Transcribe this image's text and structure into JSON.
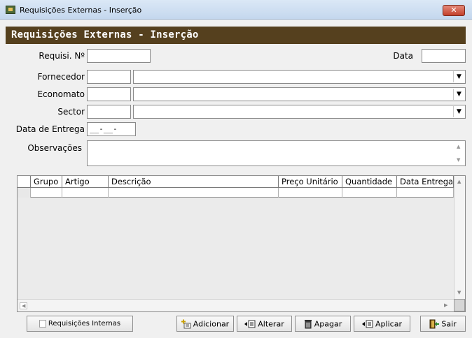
{
  "window": {
    "title": "Requisições Externas - Inserção",
    "close_label": "✕"
  },
  "header": {
    "title": "Requisições Externas - Inserção"
  },
  "form": {
    "requisicao_label": "Requisi. Nº",
    "data_label": "Data",
    "fornecedor_label": "Fornecedor",
    "economato_label": "Economato",
    "sector_label": "Sector",
    "data_entrega_label": "Data de Entrega",
    "data_entrega_value": "__-__-____",
    "observacoes_label": "Observações"
  },
  "grid": {
    "columns": [
      "Grupo",
      "Artigo",
      "Descrição",
      "Preço Unitário",
      "Quantidade",
      "Data Entrega"
    ]
  },
  "buttons": {
    "requisicoes_internas": "Requisições Internas",
    "adicionar": "Adicionar",
    "alterar": "Alterar",
    "apagar": "Apagar",
    "aplicar": "Aplicar",
    "sair": "Sair"
  },
  "icons": {
    "app": "app-icon",
    "dropdown": "chevron-down-icon",
    "adicionar": "add-icon",
    "alterar": "edit-icon",
    "apagar": "trash-icon",
    "aplicar": "apply-icon",
    "sair": "exit-door-icon"
  },
  "colors": {
    "banner": "#55401e",
    "close": "#c3402b"
  }
}
